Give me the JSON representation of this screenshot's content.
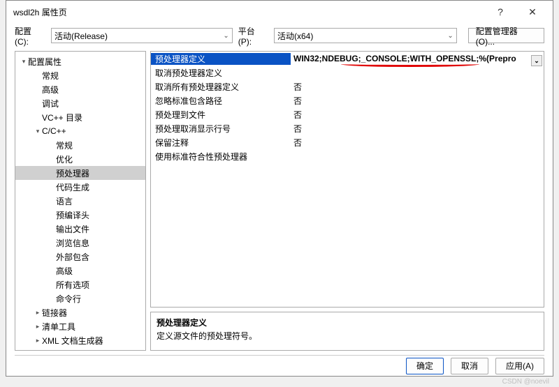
{
  "title": "wsdl2h 属性页",
  "toolbar": {
    "config_label": "配置(C):",
    "config_value": "活动(Release)",
    "platform_label": "平台(P):",
    "platform_value": "活动(x64)",
    "config_manager": "配置管理器(O)..."
  },
  "tree": [
    {
      "label": "配置属性",
      "level": 0,
      "exp": "▾"
    },
    {
      "label": "常规",
      "level": 1,
      "exp": ""
    },
    {
      "label": "高级",
      "level": 1,
      "exp": ""
    },
    {
      "label": "调试",
      "level": 1,
      "exp": ""
    },
    {
      "label": "VC++ 目录",
      "level": 1,
      "exp": ""
    },
    {
      "label": "C/C++",
      "level": 1,
      "exp": "▾"
    },
    {
      "label": "常规",
      "level": 2,
      "exp": ""
    },
    {
      "label": "优化",
      "level": 2,
      "exp": ""
    },
    {
      "label": "预处理器",
      "level": 2,
      "exp": "",
      "sel": true
    },
    {
      "label": "代码生成",
      "level": 2,
      "exp": ""
    },
    {
      "label": "语言",
      "level": 2,
      "exp": ""
    },
    {
      "label": "预编译头",
      "level": 2,
      "exp": ""
    },
    {
      "label": "输出文件",
      "level": 2,
      "exp": ""
    },
    {
      "label": "浏览信息",
      "level": 2,
      "exp": ""
    },
    {
      "label": "外部包含",
      "level": 2,
      "exp": ""
    },
    {
      "label": "高级",
      "level": 2,
      "exp": ""
    },
    {
      "label": "所有选项",
      "level": 2,
      "exp": ""
    },
    {
      "label": "命令行",
      "level": 2,
      "exp": ""
    },
    {
      "label": "链接器",
      "level": 1,
      "exp": "▸"
    },
    {
      "label": "清单工具",
      "level": 1,
      "exp": "▸"
    },
    {
      "label": "XML 文档生成器",
      "level": 1,
      "exp": "▸"
    }
  ],
  "props": [
    {
      "name": "预处理器定义",
      "value": "WIN32;NDEBUG;_CONSOLE;WITH_OPENSSL;%(Prepro",
      "sel": true
    },
    {
      "name": "取消预处理器定义",
      "value": ""
    },
    {
      "name": "取消所有预处理器定义",
      "value": "否"
    },
    {
      "name": "忽略标准包含路径",
      "value": "否"
    },
    {
      "name": "预处理到文件",
      "value": "否"
    },
    {
      "name": "预处理取消显示行号",
      "value": "否"
    },
    {
      "name": "保留注释",
      "value": "否"
    },
    {
      "name": "使用标准符合性预处理器",
      "value": ""
    }
  ],
  "desc": {
    "title": "预处理器定义",
    "text": "定义源文件的预处理符号。"
  },
  "buttons": {
    "ok": "确定",
    "cancel": "取消",
    "apply": "应用(A)"
  },
  "watermark": "CSDN @noevil"
}
